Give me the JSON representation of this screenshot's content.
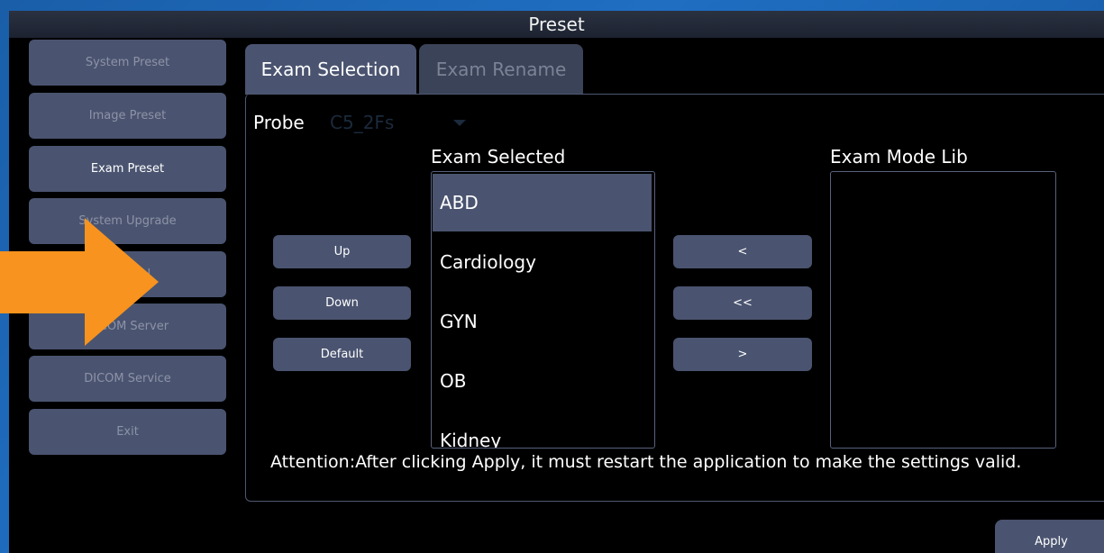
{
  "window": {
    "title": "Preset"
  },
  "sidebar": {
    "items": [
      {
        "label": "System Preset"
      },
      {
        "label": "Image Preset"
      },
      {
        "label": "Exam Preset"
      },
      {
        "label": "System Upgrade"
      },
      {
        "label": "General"
      },
      {
        "label": "DICOM Server"
      },
      {
        "label": "DICOM Service"
      },
      {
        "label": "Exit"
      }
    ]
  },
  "tabs": [
    {
      "label": "Exam Selection"
    },
    {
      "label": "Exam Rename"
    }
  ],
  "probe": {
    "label": "Probe",
    "value": "C5_2Fs"
  },
  "exam_selected": {
    "title": "Exam Selected",
    "items": [
      "ABD",
      "Cardiology",
      "GYN",
      "OB",
      "Kidney"
    ]
  },
  "exam_mode_lib": {
    "title": "Exam Mode Lib"
  },
  "buttons": {
    "up": "Up",
    "down": "Down",
    "default": "Default",
    "move_left": "<",
    "move_all_left": "<<",
    "move_right": ">"
  },
  "attention": "Attention:After clicking Apply, it must restart the application to make the settings valid.",
  "apply": "Apply",
  "colors": {
    "annotation_arrow": "#f7931e",
    "button_bg": "#4a5470"
  }
}
